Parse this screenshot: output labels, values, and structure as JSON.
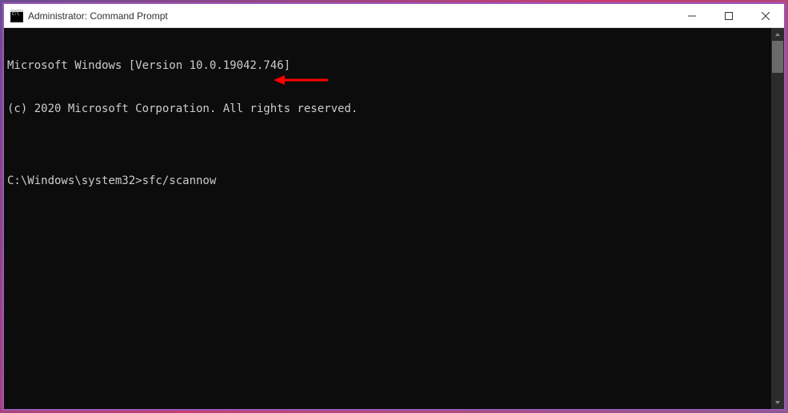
{
  "window": {
    "title": "Administrator: Command Prompt"
  },
  "console": {
    "line1": "Microsoft Windows [Version 10.0.19042.746]",
    "line2": "(c) 2020 Microsoft Corporation. All rights reserved.",
    "blank": "",
    "prompt": "C:\\Windows\\system32>",
    "command": "sfc/scannow"
  },
  "annotation": {
    "arrow_color": "#ff0000"
  }
}
